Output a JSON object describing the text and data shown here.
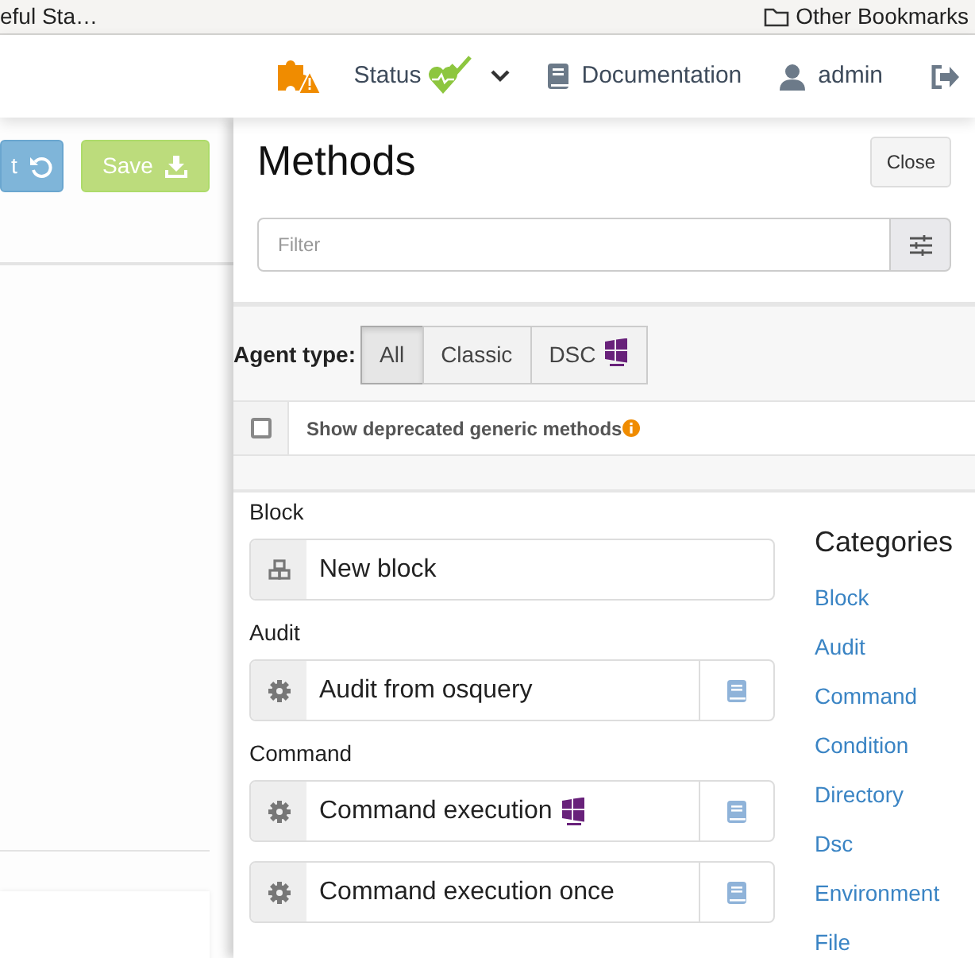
{
  "bookmarks_bar": {
    "left_item": "eful Sta…",
    "right_item": "Other Bookmarks"
  },
  "navbar": {
    "status": {
      "label": "Status"
    },
    "documentation": "Documentation",
    "user": "admin"
  },
  "toolbar": {
    "buttons": [
      {
        "label": "t",
        "kind": "reset"
      },
      {
        "label": "Save",
        "kind": "save"
      }
    ]
  },
  "panel": {
    "title": "Methods",
    "close": "Close",
    "filter": {
      "placeholder": "Filter"
    },
    "agent_type": {
      "label": "Agent type:",
      "options": [
        {
          "label": "All",
          "selected": true,
          "dsc": false
        },
        {
          "label": "Classic",
          "selected": false,
          "dsc": false
        },
        {
          "label": "DSC",
          "selected": false,
          "dsc": true
        }
      ]
    },
    "deprecated": {
      "label": "Show deprecated generic methods",
      "checked": false
    },
    "groups": [
      {
        "name": "Block",
        "methods": [
          {
            "name": "New block",
            "kind": "block",
            "dsc": false,
            "doc": false
          }
        ]
      },
      {
        "name": "Audit",
        "methods": [
          {
            "name": "Audit from osquery",
            "kind": "method",
            "dsc": false,
            "doc": true
          }
        ]
      },
      {
        "name": "Command",
        "methods": [
          {
            "name": "Command execution",
            "kind": "method",
            "dsc": true,
            "doc": true
          },
          {
            "name": "Command execution once",
            "kind": "method",
            "dsc": false,
            "doc": true
          }
        ]
      }
    ],
    "categories": {
      "title": "Categories",
      "items": [
        "Block",
        "Audit",
        "Command",
        "Condition",
        "Directory",
        "Dsc",
        "Environment",
        "File"
      ]
    }
  }
}
